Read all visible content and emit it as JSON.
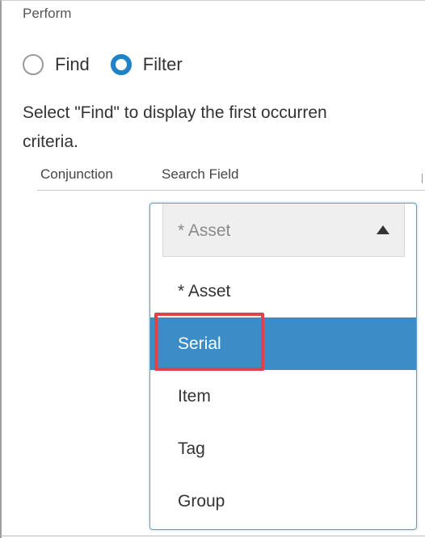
{
  "perform": {
    "label": "Perform",
    "options": [
      {
        "label": "Find",
        "checked": false
      },
      {
        "label": "Filter",
        "checked": true
      }
    ]
  },
  "help_text": {
    "line1": "Select \"Find\" to display the first occurren",
    "line2": "criteria."
  },
  "columns": {
    "conjunction": "Conjunction",
    "search_field": "Search Field"
  },
  "search_field_dropdown": {
    "selected": "* Asset",
    "options": [
      "* Asset",
      "Serial",
      "Item",
      "Tag",
      "Group"
    ],
    "highlighted_option": "Serial"
  },
  "colors": {
    "radio_checked": "#1f82c9",
    "option_highlight": "#3b8cc7",
    "callout_border": "#e0414a"
  }
}
